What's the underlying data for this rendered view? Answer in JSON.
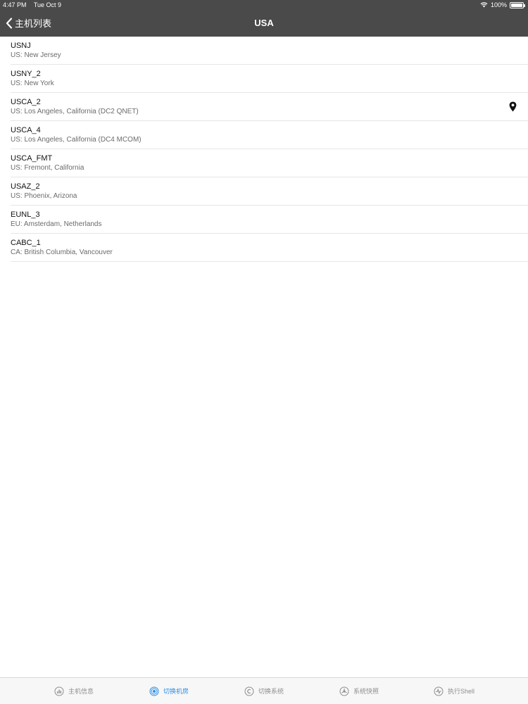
{
  "status": {
    "time": "4:47 PM",
    "date": "Tue Oct 9",
    "battery": "100%",
    "battery_level": 1.0
  },
  "nav": {
    "back_label": "主机列表",
    "title": "USA"
  },
  "items": [
    {
      "name": "USNJ",
      "location": "US: New Jersey"
    },
    {
      "name": "USNY_2",
      "location": "US: New York"
    },
    {
      "name": "USCA_2",
      "location": "US: Los Angeles, California (DC2 QNET)",
      "selected": true
    },
    {
      "name": "USCA_4",
      "location": "US: Los Angeles, California (DC4 MCOM)"
    },
    {
      "name": "USCA_FMT",
      "location": "US: Fremont, California"
    },
    {
      "name": "USAZ_2",
      "location": "US: Phoenix, Arizona"
    },
    {
      "name": "EUNL_3",
      "location": "EU: Amsterdam, Netherlands"
    },
    {
      "name": "CABC_1",
      "location": "CA: British Columbia, Vancouver"
    }
  ],
  "tabs": [
    {
      "label": "主机信息",
      "icon": "host-info-icon"
    },
    {
      "label": "切换机房",
      "icon": "switch-datacenter-icon",
      "active": true
    },
    {
      "label": "切换系统",
      "icon": "switch-system-icon"
    },
    {
      "label": "系统快照",
      "icon": "snapshot-icon"
    },
    {
      "label": "执行Shell",
      "icon": "shell-icon"
    }
  ],
  "colors": {
    "nav_background": "#4a4a4a",
    "tab_active": "#2f8fe6",
    "tab_inactive": "#8e8e8e"
  }
}
